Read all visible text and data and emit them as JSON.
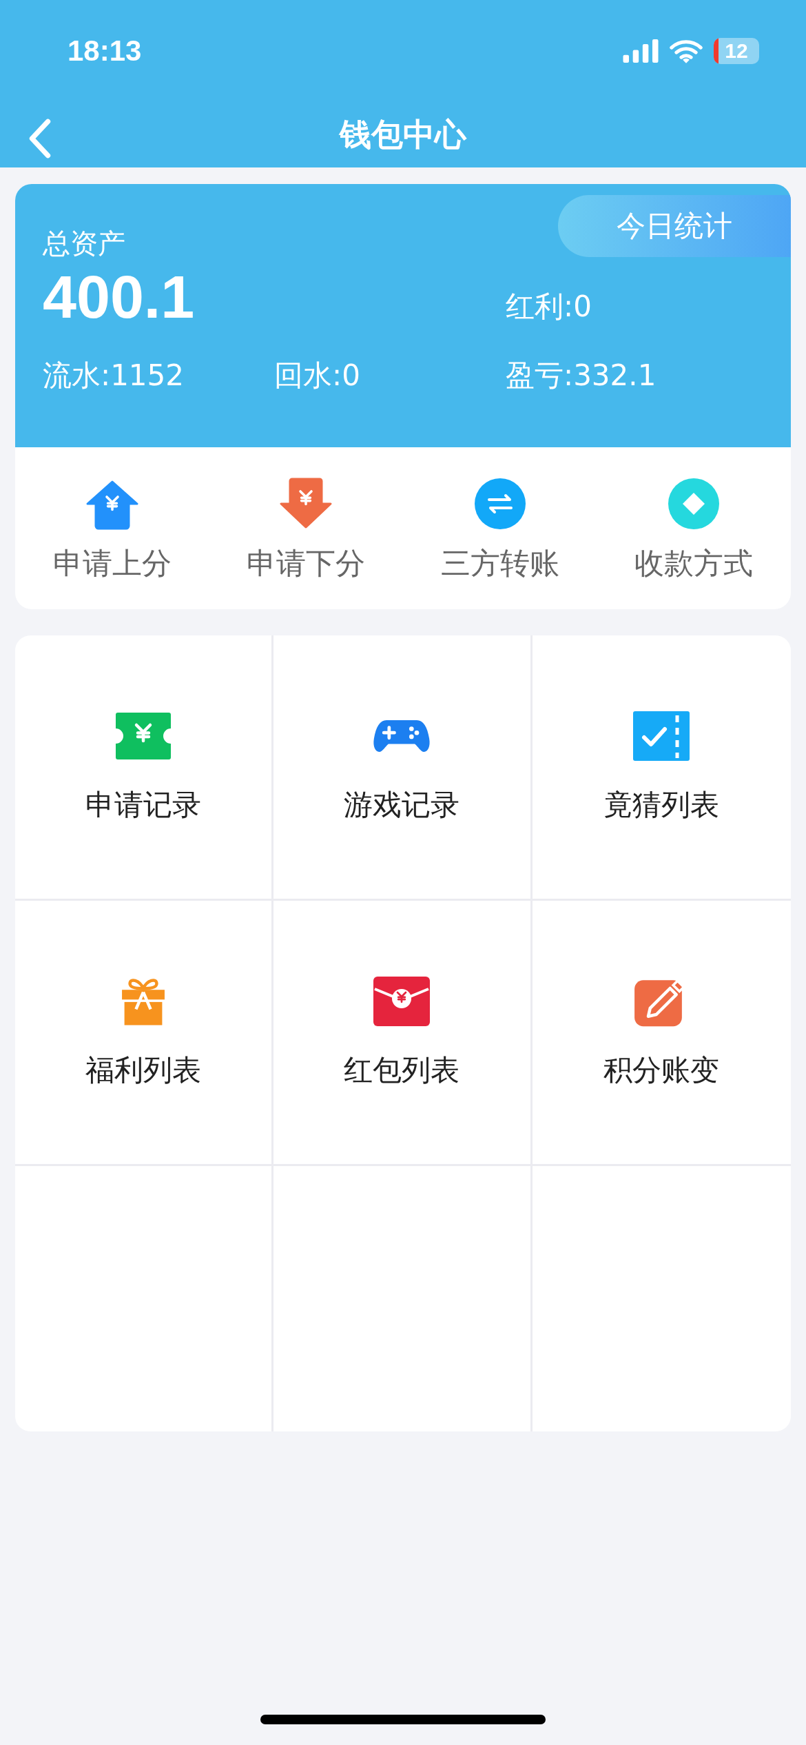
{
  "status_bar": {
    "time": "18:13",
    "battery": "12"
  },
  "nav": {
    "title": "钱包中心"
  },
  "summary": {
    "label": "总资产",
    "total": "400.1",
    "today_button": "今日统计",
    "bonus": "红利:0",
    "stats": [
      "流水:1152",
      "回水:0",
      "盈亏:332.1"
    ]
  },
  "actions": [
    {
      "label": "申请上分"
    },
    {
      "label": "申请下分"
    },
    {
      "label": "三方转账"
    },
    {
      "label": "收款方式"
    }
  ],
  "menu": [
    {
      "label": "申请记录"
    },
    {
      "label": "游戏记录"
    },
    {
      "label": "竟猜列表"
    },
    {
      "label": "福利列表"
    },
    {
      "label": "红包列表"
    },
    {
      "label": "积分账变"
    }
  ]
}
